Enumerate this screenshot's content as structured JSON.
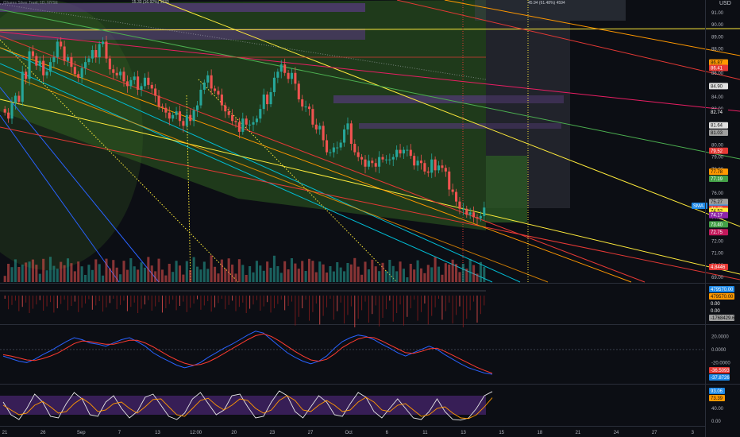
{
  "colors": {
    "background": "#0c0e14",
    "up": "#26a69a",
    "down": "#ef5350",
    "macd_line": "#2962ff",
    "signal_line": "#ff3b30",
    "stoch_k": "#e6e6e6",
    "stoch_d": "#ff9800",
    "stoch_band": "#5b2b8c",
    "channel_fill": "#2f5f20",
    "axis_text": "#b2b5be"
  },
  "header": {
    "symbol_line": "iShares Silver Trust, 1D, NYSE",
    "currency": "USD",
    "measure_left": "15.33 (16.92%) 1533",
    "measure_right": "45.94 (61.48%) 4594"
  },
  "chart_data": [
    {
      "type": "candlestick",
      "title": "",
      "x_ticks": [
        "21",
        "26",
        "Sep",
        "7",
        "13",
        "12:00",
        "20",
        "23",
        "27",
        "Oct",
        "6",
        "11",
        "13",
        "15",
        "18",
        "21",
        "24",
        "27",
        "3"
      ],
      "y_ticks": [
        "91.00",
        "90.00",
        "89.00",
        "88.00",
        "86.00",
        "84.00",
        "83.00",
        "81.00",
        "80.00",
        "79.00",
        "78.00",
        "76.00",
        "74.00",
        "72.00",
        "71.00",
        "70.00",
        "69.00"
      ],
      "ylim": [
        68.8,
        91.8
      ],
      "close": [
        82.7,
        82.2,
        83.5,
        84.1,
        83.6,
        86.1,
        85.5,
        87.8,
        87.4,
        86.6,
        87.0,
        85.8,
        86.1,
        86.9,
        87.3,
        88.6,
        88.2,
        87.0,
        87.3,
        86.5,
        85.9,
        85.6,
        86.4,
        86.9,
        87.2,
        87.9,
        87.3,
        88.4,
        88.6,
        87.2,
        86.3,
        86.0,
        85.8,
        86.1,
        85.3,
        84.9,
        85.4,
        85.7,
        84.6,
        84.9,
        85.6,
        85.0,
        84.7,
        84.1,
        83.2,
        83.1,
        82.7,
        82.2,
        82.5,
        82.8,
        82.0,
        81.6,
        82.5,
        82.0,
        82.9,
        83.3,
        84.6,
        85.2,
        85.8,
        84.7,
        84.5,
        84.2,
        83.3,
        82.8,
        82.5,
        82.0,
        81.9,
        81.1,
        82.2,
        81.7,
        81.7,
        81.9,
        82.2,
        83.0,
        84.2,
        83.4,
        84.4,
        85.6,
        86.1,
        86.7,
        86.0,
        85.5,
        86.0,
        85.1,
        83.8,
        83.2,
        83.2,
        83.0,
        81.7,
        81.3,
        81.6,
        80.4,
        79.4,
        79.4,
        79.8,
        79.8,
        80.2,
        81.3,
        81.8,
        80.1,
        79.4,
        79.0,
        78.8,
        78.2,
        78.7,
        78.5,
        78.2,
        79.0,
        78.8,
        78.8,
        78.8,
        79.0,
        79.6,
        79.3,
        79.6,
        79.6,
        79.1,
        78.3,
        78.7,
        78.5,
        77.8,
        77.7,
        78.8,
        77.9,
        78.3,
        78.1,
        77.8,
        76.3,
        76.1,
        75.3,
        74.7,
        74.7,
        74.2,
        74.4,
        74.0,
        73.9,
        74.1,
        74.8
      ],
      "volume_note": "relative volume bars per candle",
      "price_labels": [
        {
          "value": "86.87",
          "bg": "#ff9800"
        },
        {
          "value": "86.41",
          "bg": "#e53935"
        },
        {
          "value": "84.90",
          "bg": "#e0e0e0"
        },
        {
          "value": "82.74",
          "bg": "#0c0e14"
        },
        {
          "value": "81.64",
          "bg": "#e0e0e0"
        },
        {
          "value": "81.03",
          "bg": "#9e9e9e"
        },
        {
          "value": "79.52",
          "bg": "#e53935"
        },
        {
          "value": "77.78",
          "bg": "#ff9800"
        },
        {
          "value": "77.19",
          "bg": "#43a047"
        },
        {
          "value": "75.27",
          "bg": "#9e9e9e"
        },
        {
          "value": "74.78",
          "bg": "#2196f3"
        },
        {
          "value": "74.70",
          "bg": "#e53935"
        },
        {
          "value": "74.52",
          "bg": "#ffeb3b"
        },
        {
          "value": "74.17",
          "bg": "#8e24aa"
        },
        {
          "value": "73.40",
          "bg": "#43a047"
        },
        {
          "value": "72.75",
          "bg": "#c2185b"
        },
        {
          "value": "4.8446",
          "bg": "#e53935"
        }
      ],
      "current_tag": "SMA"
    },
    {
      "type": "bar",
      "title": "",
      "y_labels": [
        {
          "value": "479570.00",
          "bg": "#1e88e5"
        },
        {
          "value": "479570.00",
          "bg": "#ff9800"
        },
        {
          "value": "0.00",
          "bg": "#0c0e14"
        },
        {
          "value": "0.00",
          "bg": "#0c0e14"
        },
        {
          "value": "-1768429.63",
          "bg": "#9e9e9e"
        }
      ]
    },
    {
      "type": "line",
      "title": "",
      "y_ticks": [
        "20.0000",
        "0.0000",
        "-20.0000"
      ],
      "ylim": [
        -50,
        35
      ],
      "series": [
        {
          "values": [
            -10,
            -14,
            -18,
            -20,
            -15,
            -8,
            -2,
            5,
            12,
            18,
            15,
            10,
            8,
            5,
            10,
            15,
            18,
            12,
            5,
            -5,
            -12,
            -18,
            -24,
            -28,
            -25,
            -20,
            -12,
            -5,
            2,
            8,
            15,
            22,
            28,
            25,
            15,
            5,
            -5,
            -12,
            -18,
            -22,
            -18,
            -10,
            2,
            12,
            18,
            22,
            20,
            15,
            8,
            2,
            -5,
            -10,
            -5,
            0,
            5,
            0,
            -8,
            -15,
            -22,
            -28,
            -32,
            -36,
            -37.8
          ]
        },
        {
          "values": [
            -8,
            -10,
            -13,
            -16,
            -17,
            -14,
            -10,
            -5,
            2,
            9,
            13,
            12,
            10,
            8,
            8,
            11,
            14,
            14,
            10,
            4,
            -3,
            -10,
            -16,
            -21,
            -24,
            -23,
            -19,
            -13,
            -6,
            1,
            8,
            15,
            21,
            24,
            20,
            13,
            5,
            -3,
            -10,
            -16,
            -18,
            -15,
            -7,
            3,
            10,
            16,
            19,
            18,
            13,
            7,
            1,
            -5,
            -6,
            -3,
            1,
            2,
            -3,
            -9,
            -15,
            -21,
            -27,
            -32,
            -36.5
          ]
        }
      ],
      "value_labels": [
        {
          "value": "-36.5093",
          "bg": "#e53935"
        },
        {
          "value": "-37.8726",
          "bg": "#1e88e5"
        }
      ]
    },
    {
      "type": "line",
      "title": "",
      "y_ticks": [
        "40.00",
        "0.00"
      ],
      "ylim": [
        -10,
        110
      ],
      "series": [
        {
          "values": [
            60,
            20,
            5,
            40,
            85,
            60,
            15,
            10,
            55,
            90,
            70,
            20,
            15,
            60,
            80,
            40,
            10,
            30,
            75,
            85,
            50,
            15,
            5,
            25,
            70,
            90,
            55,
            20,
            35,
            80,
            85,
            45,
            10,
            15,
            60,
            95,
            80,
            30,
            10,
            45,
            80,
            60,
            20,
            15,
            55,
            90,
            75,
            30,
            10,
            40,
            70,
            40,
            10,
            5,
            30,
            70,
            30,
            5,
            3,
            10,
            40,
            80,
            93.06
          ]
        },
        {
          "values": [
            50,
            35,
            20,
            25,
            50,
            62,
            45,
            25,
            30,
            55,
            72,
            55,
            30,
            35,
            55,
            60,
            40,
            25,
            45,
            68,
            70,
            45,
            20,
            15,
            40,
            65,
            72,
            50,
            35,
            50,
            70,
            65,
            40,
            25,
            35,
            65,
            80,
            65,
            35,
            30,
            50,
            65,
            50,
            30,
            35,
            60,
            75,
            60,
            35,
            30,
            50,
            55,
            35,
            15,
            20,
            40,
            45,
            25,
            10,
            8,
            20,
            45,
            73.39
          ]
        }
      ],
      "value_labels": [
        {
          "value": "93.06",
          "bg": "#1e88e5"
        },
        {
          "value": "73.39",
          "bg": "#ff9800"
        }
      ]
    }
  ]
}
